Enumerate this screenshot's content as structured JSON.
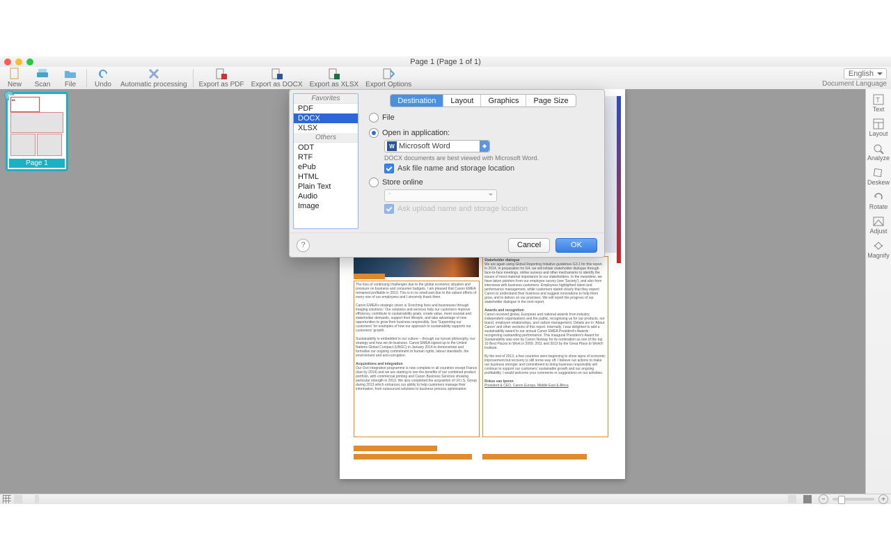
{
  "window": {
    "title": "Page 1 (Page 1 of 1)"
  },
  "toolbar": {
    "new": "New",
    "scan": "Scan",
    "file": "File",
    "undo": "Undo",
    "auto": "Automatic processing",
    "exp_pdf": "Export as PDF",
    "exp_docx": "Export as DOCX",
    "exp_xlsx": "Export as XLSX",
    "exp_opts": "Export Options"
  },
  "language": {
    "value": "English",
    "caption": "Document Language"
  },
  "thumb": {
    "label": "Page 1"
  },
  "right_tools": {
    "text": "Text",
    "layout": "Layout",
    "analyze": "Analyze",
    "deskew": "Deskew",
    "rotate": "Rotate",
    "adjust": "Adjust",
    "magnify": "Magnify"
  },
  "dialog": {
    "tabs": {
      "destination": "Destination",
      "layout": "Layout",
      "graphics": "Graphics",
      "page_size": "Page Size"
    },
    "formats": {
      "favorites_hdr": "Favorites",
      "others_hdr": "Others",
      "pdf": "PDF",
      "docx": "DOCX",
      "xlsx": "XLSX",
      "odt": "ODT",
      "rtf": "RTF",
      "epub": "ePub",
      "html": "HTML",
      "plain": "Plain Text",
      "audio": "Audio",
      "image": "Image"
    },
    "dest": {
      "file": "File",
      "open_in_app": "Open in application:",
      "app_name": "Microsoft Word",
      "hint": "DOCX documents are best viewed with Microsoft Word.",
      "ask_filename": "Ask file name and storage location",
      "store_online": "Store online",
      "store_placeholder": "-",
      "ask_upload": "Ask upload name and storage location"
    },
    "buttons": {
      "cancel": "Cancel",
      "ok": "OK",
      "help": "?"
    }
  },
  "page_text": {
    "h1": "Stakeholder dialogue",
    "h2": "Awards and recognition",
    "h3": "Acquisitions and integration",
    "sig": "Rokus van Iperen",
    "sig2": "President & CEO, Canon Europe, Middle East & Africa"
  }
}
